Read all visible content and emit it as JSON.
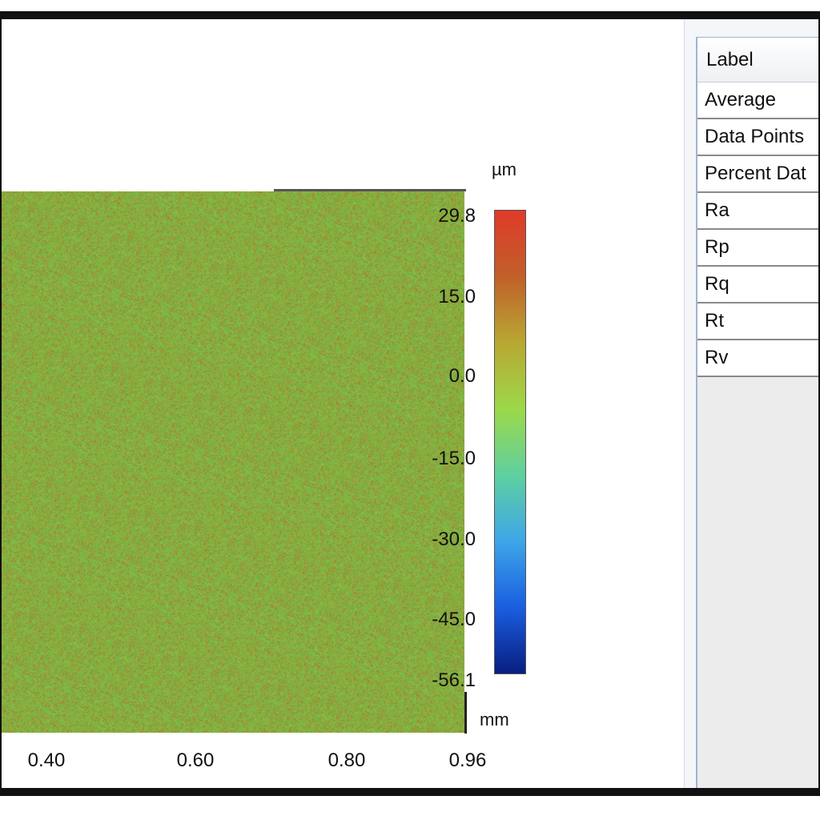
{
  "x_axis": {
    "unit": "mm",
    "ticks": [
      "0.40",
      "0.60",
      "0.80",
      "0.96"
    ]
  },
  "colorbar": {
    "unit": "µm",
    "ticks": [
      "29.8",
      "15.0",
      "0.0",
      "-15.0",
      "-30.0",
      "-45.0",
      "-56.1"
    ],
    "min": -56.1,
    "max": 29.8,
    "colors": [
      "#081e80",
      "#1a5ee0",
      "#3ea6e8",
      "#5fd0a0",
      "#9cd84a",
      "#b8a832",
      "#c0602a",
      "#e03a2a"
    ]
  },
  "table": {
    "header": "Label",
    "rows": [
      "Average",
      "Data Points",
      "Percent Dat",
      "Ra",
      "Rp",
      "Rq",
      "Rt",
      "Rv"
    ]
  }
}
